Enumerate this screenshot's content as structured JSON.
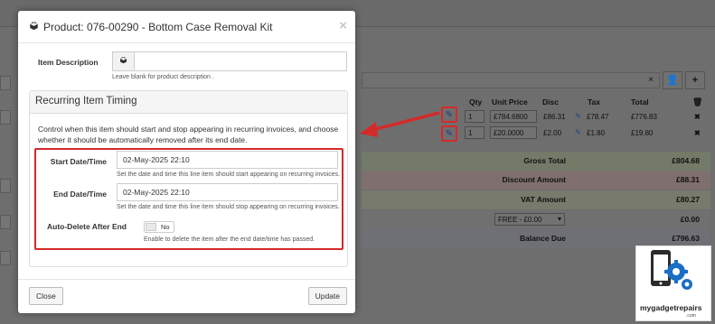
{
  "modal": {
    "title": "Product: 076-00290 - Bottom Case Removal Kit",
    "close_glyph": "×",
    "item_description_label": "Item Description",
    "item_description_value": "",
    "item_description_help": "Leave blank for product description .",
    "panel_title": "Recurring Item Timing",
    "panel_text": "Control when this item should start and stop appearing in recurring invoices, and choose whether it should be automatically removed after its end date.",
    "start_label": "Start Date/Time",
    "start_value": "02-May-2025 22:10",
    "start_help": "Set the date and time this line item should start appearing on recurring invoices.",
    "end_label": "End Date/Time",
    "end_value": "02-May-2025 22:10",
    "end_help": "Set the date and time this line item should stop appearing on recurring invoices.",
    "auto_delete_label": "Auto-Delete After End",
    "auto_delete_value": "No",
    "auto_delete_help": "Enable to delete the item after the end date/time has passed.",
    "close_button": "Close",
    "update_button": "Update"
  },
  "background": {
    "select_clear": "×",
    "columns": [
      "Qty",
      "Unit Price",
      "Disc",
      "Tax",
      "Total"
    ],
    "rows": [
      {
        "qty": "1",
        "unit_price": "£784.6800",
        "disc": "£86.31",
        "tax": "£78.47",
        "total": "£776.83",
        "delete": "✖"
      },
      {
        "qty": "1",
        "unit_price": "£20.0000",
        "disc": "£2.00",
        "tax": "£1.80",
        "total": "£19.80",
        "delete": "✖"
      }
    ],
    "summary": [
      {
        "label": "Gross Total",
        "value": "£804.68"
      },
      {
        "label": "Discount Amount",
        "value": "£88.31"
      },
      {
        "label": "VAT Amount",
        "value": "£80.27"
      },
      {
        "label": "",
        "value": "£0.00"
      },
      {
        "label": "Balance Due",
        "value": "£796.63"
      }
    ],
    "shipping_select": "FREE - £0.00"
  },
  "logo": {
    "text": "mygadgetrepairs",
    "sub": ".com"
  },
  "colors": {
    "annotation_red": "#d42a2a",
    "logo_blue": "#1a6fc4"
  }
}
